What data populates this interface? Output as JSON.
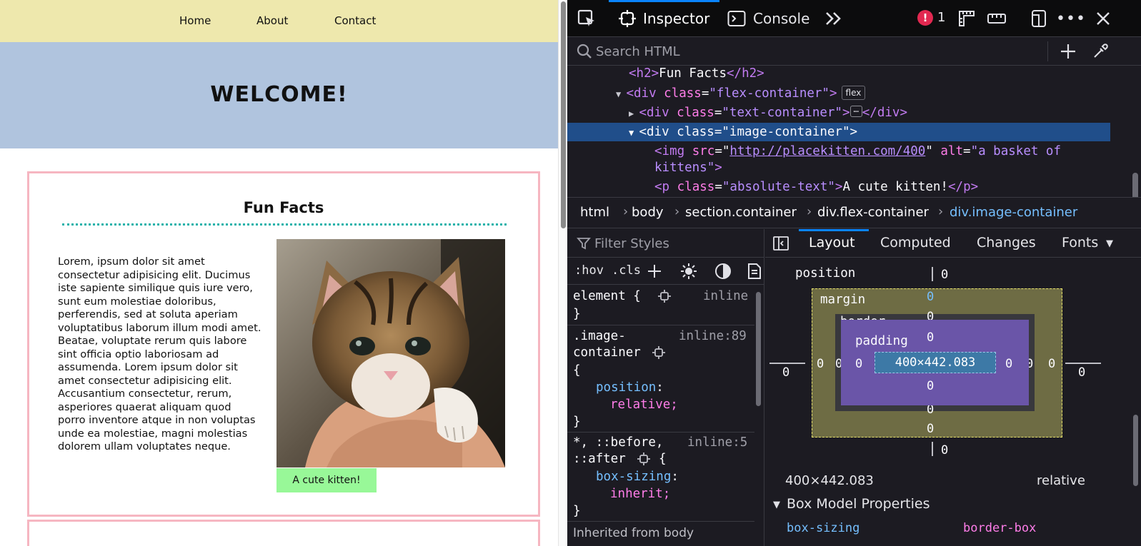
{
  "page": {
    "nav": [
      "Home",
      "About",
      "Contact"
    ],
    "hero_title": "WELCOME!",
    "section_title": "Fun Facts",
    "lorem": "Lorem, ipsum dolor sit amet consectetur adipisicing elit. Ducimus iste sapiente similique quis iure vero, sunt eum molestiae doloribus, perferendis, sed at soluta aperiam voluptatibus laborum illum modi amet. Beatae, voluptate rerum quis labore sint officia optio laboriosam ad assumenda. Lorem ipsum dolor sit amet consectetur adipisicing elit. Accusantium consectetur, rerum, asperiores quaerat aliquam quod porro inventore atque in non voluptas unde ea molestiae, magni molestias dolorem ullam voluptates neque.",
    "image_alt": "a basket of kittens",
    "caption": "A cute kitten!"
  },
  "devtools": {
    "tabs": {
      "inspector": "Inspector",
      "console": "Console"
    },
    "error_count": "1",
    "search_placeholder": "Search HTML",
    "markup": {
      "line1": {
        "open": "<",
        "tag": "h2",
        "close": ">",
        "text": "Fun Facts",
        "end_open": "</",
        "end_tag": "h2",
        "end_close": ">"
      },
      "line2": {
        "tag": "div",
        "attr": "class",
        "value": "\"flex-container\"",
        "badge": "flex"
      },
      "line3": {
        "tag": "div",
        "attr": "class",
        "value": "\"text-container\"",
        "end_tag": "div"
      },
      "line4": {
        "tag": "div",
        "attr": "class",
        "value": "\"image-container\""
      },
      "line5": {
        "tag": "img",
        "attr1": "src",
        "url": "http://placekitten.com/400",
        "attr2": "alt",
        "value2a": "\"a basket of",
        "value2b": "kittens\""
      },
      "line6": {
        "tag": "p",
        "attr": "class",
        "value": "\"absolute-text\"",
        "text": "A cute kitten!",
        "end_tag": "p"
      }
    },
    "breadcrumbs": [
      {
        "name": "html",
        "cls": ""
      },
      {
        "name": "body",
        "cls": ""
      },
      {
        "name": "section",
        "cls": ".container"
      },
      {
        "name": "div",
        "cls": ".flex-container"
      },
      {
        "name": "div",
        "cls": ".image-container"
      }
    ],
    "rules": {
      "filter_placeholder": "Filter Styles",
      "hov": ":hov",
      "cls": ".cls",
      "r1": {
        "selector": "element {",
        "source": "inline",
        "close": "}"
      },
      "r2": {
        "selector1": ".image-",
        "selector2": "container",
        "source": "inline:89",
        "open": "{",
        "prop": "position",
        "value": "relative;",
        "close": "}"
      },
      "r3": {
        "selector1": "*, ::before,",
        "selector2": "::after",
        "source": "inline:5",
        "open": "{",
        "prop": "box-sizing",
        "value": "inherit;",
        "close": "}"
      },
      "inherited": "Inherited from body"
    },
    "layout": {
      "tabs": [
        "Layout",
        "Computed",
        "Changes",
        "Fonts"
      ],
      "position_label": "position",
      "margin_label": "margin",
      "border_label": "border",
      "padding_label": "padding",
      "content_size": "400×442.083",
      "zero": "0",
      "summary_size": "400×442.083",
      "summary_position": "relative",
      "section_title": "Box Model Properties",
      "prop_name": "box-sizing",
      "prop_value": "border-box"
    }
  },
  "colors": {
    "nav_bg": "#eee8ad",
    "hero_bg": "#b0c4de",
    "card_border": "#f6b6c1",
    "dots": "#20b2aa",
    "caption_bg": "#98f898",
    "selection": "#204e8a",
    "accent": "#0a84ff"
  }
}
